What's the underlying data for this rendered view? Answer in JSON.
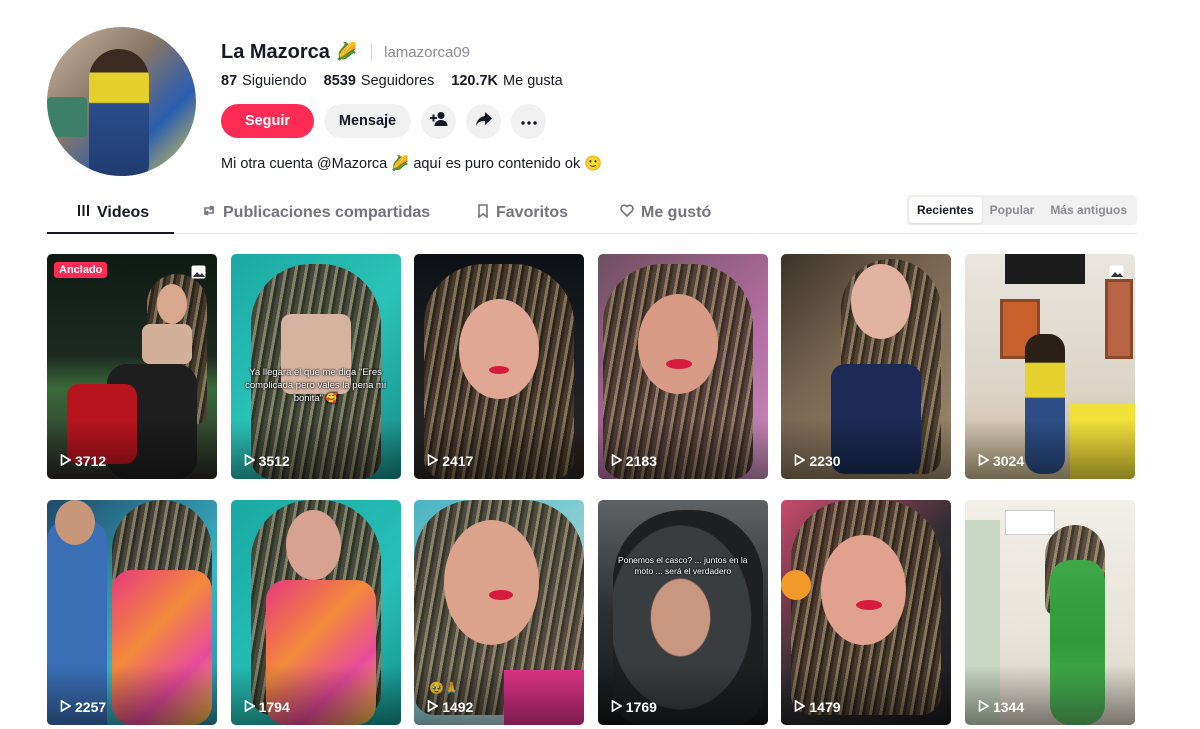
{
  "profile": {
    "display_name": "La Mazorca",
    "name_emoji": "🌽",
    "username": "lamazorca09",
    "stats": [
      {
        "value": "87",
        "label": "Siguiendo"
      },
      {
        "value": "8539",
        "label": "Seguidores"
      },
      {
        "value": "120.7K",
        "label": "Me gusta"
      }
    ],
    "follow_label": "Seguir",
    "message_label": "Mensaje",
    "bio": "Mi otra cuenta @Mazorca 🌽 aquí es puro contenido ok 🙂"
  },
  "tabs": [
    {
      "label": "Videos",
      "icon": "grid-icon"
    },
    {
      "label": "Publicaciones compartidas",
      "icon": "repost-icon"
    },
    {
      "label": "Favoritos",
      "icon": "bookmark-icon"
    },
    {
      "label": "Me gustó",
      "icon": "heart-icon"
    }
  ],
  "sort": {
    "options": [
      "Recientes",
      "Popular",
      "Más antiguos"
    ],
    "selected": "Recientes"
  },
  "videos": [
    {
      "views": "3712",
      "pinned": "Anclado",
      "photo": true
    },
    {
      "views": "3512",
      "caption": "Ya llegara el que me diga \"Eres complicada pero vales la pena mi bonita\" 🥰"
    },
    {
      "views": "2417"
    },
    {
      "views": "2183"
    },
    {
      "views": "2230"
    },
    {
      "views": "3024",
      "photo": true
    },
    {
      "views": "2257"
    },
    {
      "views": "1794"
    },
    {
      "views": "1492"
    },
    {
      "views": "1769",
      "caption": "Ponemos el casco? ... juntos en la moto ... será el verdadero"
    },
    {
      "views": "1479"
    },
    {
      "views": "1344"
    }
  ],
  "colors": {
    "accent": "#fe2c55",
    "text": "#161823",
    "muted": "#8a8b91"
  }
}
